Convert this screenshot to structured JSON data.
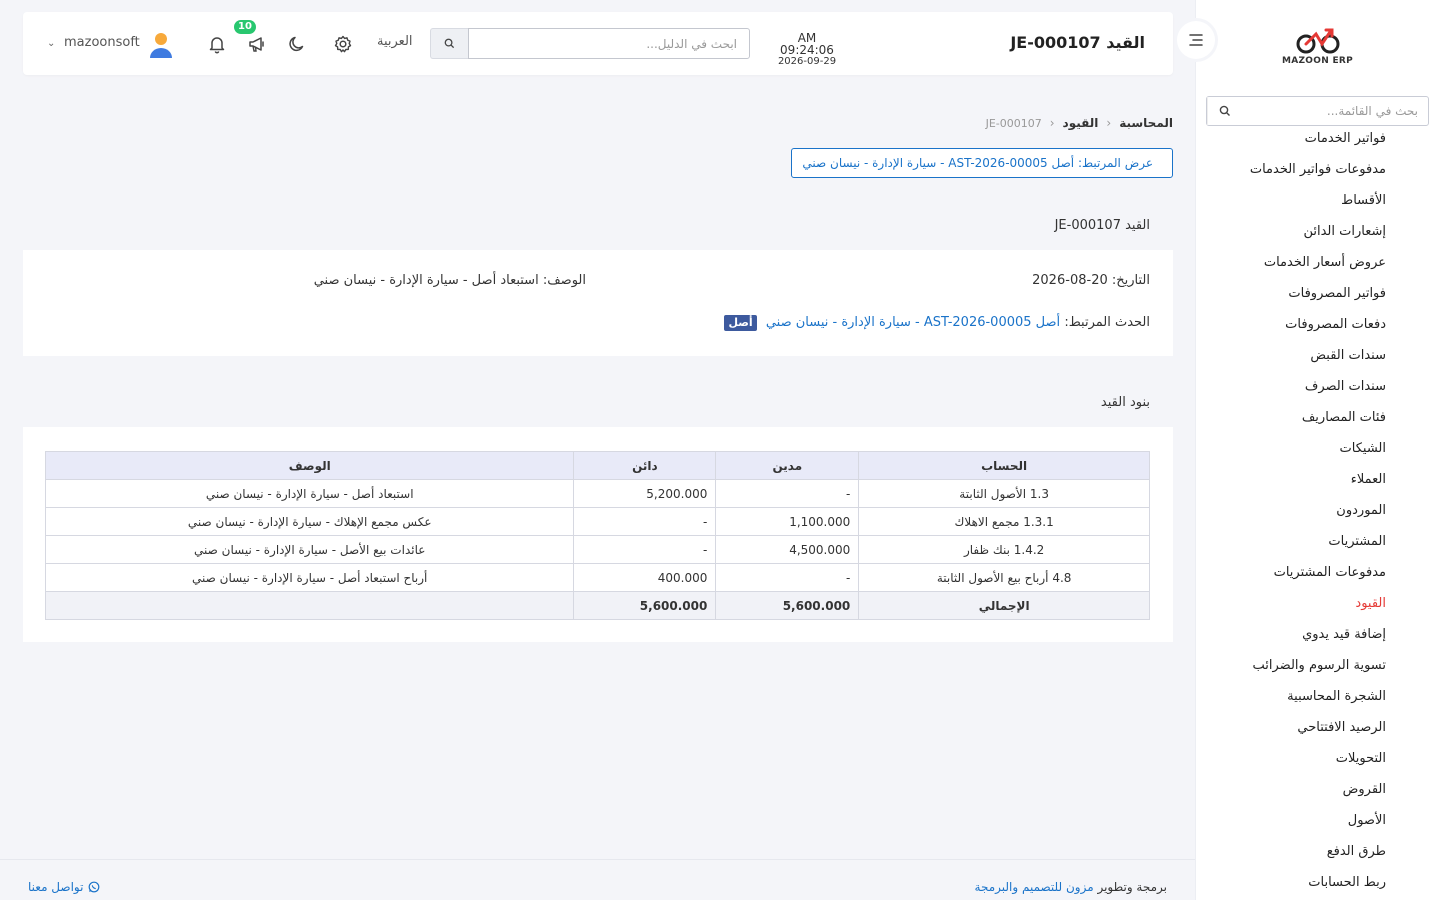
{
  "brand": {
    "name": "MAZOON ERP"
  },
  "sidebar": {
    "search_placeholder": "بحث في القائمة...",
    "items": [
      {
        "label": "فواتير الخدمات",
        "active": false
      },
      {
        "label": "مدفوعات فواتير الخدمات",
        "active": false
      },
      {
        "label": "الأقساط",
        "active": false
      },
      {
        "label": "إشعارات الدائن",
        "active": false
      },
      {
        "label": "عروض أسعار الخدمات",
        "active": false
      },
      {
        "label": "فواتير المصروفات",
        "active": false
      },
      {
        "label": "دفعات المصروفات",
        "active": false
      },
      {
        "label": "سندات القبض",
        "active": false
      },
      {
        "label": "سندات الصرف",
        "active": false
      },
      {
        "label": "فئات المصاريف",
        "active": false
      },
      {
        "label": "الشيكات",
        "active": false
      },
      {
        "label": "العملاء",
        "active": false
      },
      {
        "label": "الموردون",
        "active": false
      },
      {
        "label": "المشتريات",
        "active": false
      },
      {
        "label": "مدفوعات المشتريات",
        "active": false
      },
      {
        "label": "القيود",
        "active": true
      },
      {
        "label": "إضافة قيد يدوي",
        "active": false
      },
      {
        "label": "تسوية الرسوم والضرائب",
        "active": false
      },
      {
        "label": "الشجرة المحاسبية",
        "active": false
      },
      {
        "label": "الرصيد الافتتاحي",
        "active": false
      },
      {
        "label": "التحويلات",
        "active": false
      },
      {
        "label": "القروض",
        "active": false
      },
      {
        "label": "الأصول",
        "active": false
      },
      {
        "label": "طرق الدفع",
        "active": false
      },
      {
        "label": "ربط الحسابات",
        "active": false
      }
    ]
  },
  "header": {
    "title": "القيد JE-000107",
    "time": "AM 09:24:06",
    "date": "2026-09-29",
    "search_placeholder": "ابحث في الدليل...",
    "language": "العربية",
    "notification_count": "10",
    "username": "mazoonsoft"
  },
  "breadcrumb": {
    "level1": "المحاسبة",
    "level2": "القيود",
    "level3": "JE-000107"
  },
  "linked_button": "عرض المرتبط: أصل AST-2026-00005 - سيارة الإدارة - نيسان صني",
  "entry": {
    "heading": "القيد JE-000107",
    "date_label": "التاريخ:",
    "date_value": "20-08-2026",
    "description_label": "الوصف:",
    "description_value": "استبعاد أصل - سيارة الإدارة - نيسان صني",
    "linked_event_label": "الحدث المرتبط:",
    "linked_event_value": "أصل AST-2026-00005 - سيارة الإدارة - نيسان صني",
    "linked_event_tag": "أصل"
  },
  "lines": {
    "heading": "بنود القيد",
    "columns": {
      "account": "الحساب",
      "debit": "مدين",
      "credit": "دائن",
      "description": "الوصف"
    },
    "rows": [
      {
        "account": "1.3 الأصول الثابتة",
        "debit": "-",
        "credit": "5,200.000",
        "description": "استبعاد أصل - سيارة الإدارة - نيسان صني"
      },
      {
        "account": "1.3.1 مجمع الاهلاك",
        "debit": "1,100.000",
        "credit": "-",
        "description": "عكس مجمع الإهلاك - سيارة الإدارة - نيسان صني"
      },
      {
        "account": "1.4.2 بنك ظفار",
        "debit": "4,500.000",
        "credit": "-",
        "description": "عائدات بيع الأصل - سيارة الإدارة - نيسان صني"
      },
      {
        "account": "4.8 أرباح بيع الأصول الثابتة",
        "debit": "-",
        "credit": "400.000",
        "description": "أرباح استبعاد أصل - سيارة الإدارة - نيسان صني"
      }
    ],
    "total": {
      "label": "الإجمالي",
      "debit": "5,600.000",
      "credit": "5,600.000"
    }
  },
  "footer": {
    "credit_prefix": "برمجة وتطوير",
    "credit_link": "مزون للتصميم والبرمجة",
    "contact": "تواصل معنا"
  },
  "colors": {
    "accent": "#1a73c9",
    "active_menu": "#e53935",
    "badge": "#28c76f",
    "tag": "#3d5a9e"
  }
}
